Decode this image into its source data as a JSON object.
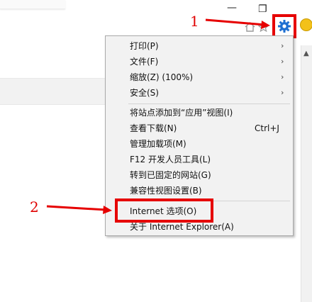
{
  "window": {
    "minimize_glyph": "—",
    "restore_glyph": "❐"
  },
  "toolbar": {
    "home_icon": "home-icon",
    "star_icon": "star-icon",
    "gear_icon": "gear-icon"
  },
  "menu": {
    "items": [
      {
        "label": "打印(P)",
        "submenu": true
      },
      {
        "label": "文件(F)",
        "submenu": true
      },
      {
        "label": "缩放(Z) (100%)",
        "submenu": true
      },
      {
        "label": "安全(S)",
        "submenu": true
      },
      {
        "label": "将站点添加到“应用”视图(I)"
      },
      {
        "label": "查看下载(N)",
        "shortcut": "Ctrl+J"
      },
      {
        "label": "管理加载项(M)"
      },
      {
        "label": "F12 开发人员工具(L)"
      },
      {
        "label": "转到已固定的网站(G)"
      },
      {
        "label": "兼容性视图设置(B)"
      },
      {
        "label": "Internet 选项(O)"
      },
      {
        "label": "关于 Internet Explorer(A)"
      }
    ],
    "submenu_glyph": "›"
  },
  "annotations": {
    "step1": "1",
    "step2": "2",
    "color": "#e60000"
  }
}
